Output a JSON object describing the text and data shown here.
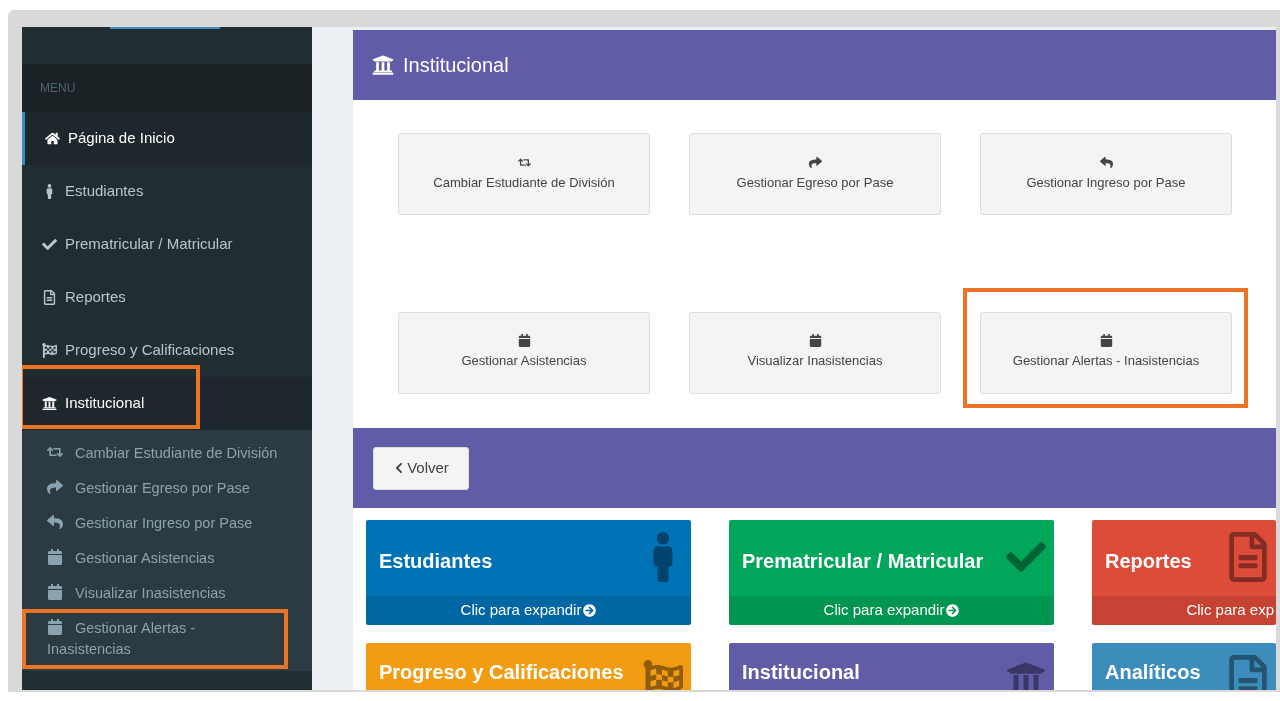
{
  "sidebar": {
    "header": "MENU",
    "items": [
      {
        "label": "Página de Inicio",
        "selected": true,
        "expanded": false,
        "annotated": false
      },
      {
        "label": "Estudiantes",
        "selected": false,
        "expanded": false,
        "annotated": false
      },
      {
        "label": "Prematricular / Matricular",
        "selected": false,
        "expanded": false,
        "annotated": false
      },
      {
        "label": "Reportes",
        "selected": false,
        "expanded": false,
        "annotated": false
      },
      {
        "label": "Progreso y Calificaciones",
        "selected": false,
        "expanded": false,
        "annotated": false
      },
      {
        "label": "Institucional",
        "selected": false,
        "expanded": true,
        "annotated": true,
        "children": [
          {
            "label": "Cambiar Estudiante de División",
            "annotated": false
          },
          {
            "label": "Gestionar Egreso por Pase",
            "annotated": false
          },
          {
            "label": "Gestionar Ingreso por Pase",
            "annotated": false
          },
          {
            "label": "Gestionar Asistencias",
            "annotated": false
          },
          {
            "label": "Visualizar Inasistencias",
            "annotated": false
          },
          {
            "label": "Gestionar Alertas - Inasistencias",
            "annotated": true
          }
        ]
      }
    ]
  },
  "panel": {
    "title": "Institucional",
    "actions": [
      {
        "label": "Cambiar Estudiante de División",
        "annotated": false
      },
      {
        "label": "Gestionar Egreso por Pase",
        "annotated": false
      },
      {
        "label": "Gestionar Ingreso por Pase",
        "annotated": false
      },
      {
        "label": "Gestionar Asistencias",
        "annotated": false
      },
      {
        "label": "Visualizar Inasistencias",
        "annotated": false
      },
      {
        "label": "Gestionar Alertas - Inasistencias",
        "annotated": true
      }
    ]
  },
  "back_button": "Volver",
  "tiles": [
    {
      "title": "Estudiantes",
      "footer": "Clic para expandir",
      "color": "#0073b7"
    },
    {
      "title": "Prematricular / Matricular",
      "footer": "Clic para expandir",
      "color": "#00a65a"
    },
    {
      "title": "Reportes",
      "footer": "Clic para exp",
      "color": "#dd4b39"
    },
    {
      "title": "Progreso y Calificaciones",
      "color": "#f39c12"
    },
    {
      "title": "Institucional",
      "color": "#605ca8"
    },
    {
      "title": "Analíticos",
      "color": "#3c8dbc"
    }
  ]
}
